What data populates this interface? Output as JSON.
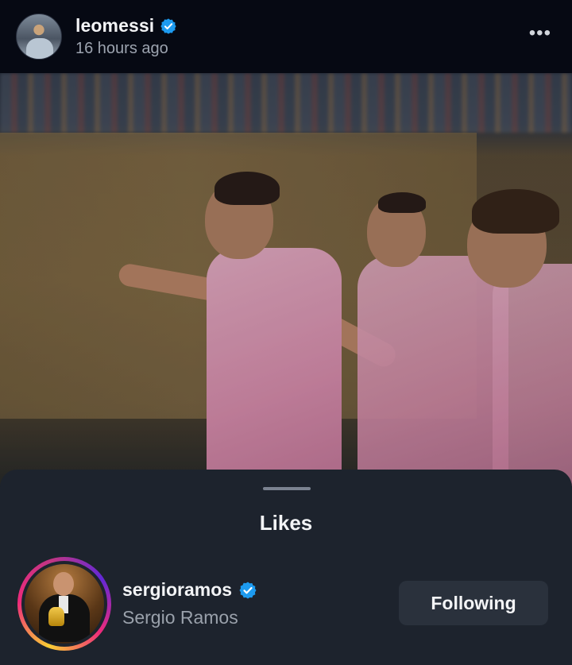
{
  "post": {
    "author": {
      "username": "leomessi",
      "verified": true,
      "time_ago": "16 hours ago"
    },
    "more_icon": "more-horizontal-icon"
  },
  "likes_sheet": {
    "title": "Likes",
    "users": [
      {
        "username": "sergioramos",
        "verified": true,
        "full_name": "Sergio Ramos",
        "follow_label": "Following",
        "has_story_ring": true
      }
    ]
  },
  "colors": {
    "verified_badge": "#1d9bf0",
    "sheet_background": "#1d232d",
    "header_background": "#060913",
    "button_background": "#2a313c"
  }
}
